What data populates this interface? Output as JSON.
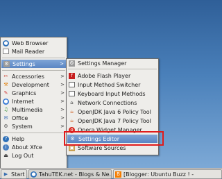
{
  "main_menu": {
    "items": [
      {
        "label": "Web Browser",
        "icon": "globe-icon",
        "submenu": false
      },
      {
        "label": "Mail Reader",
        "icon": "mail-icon",
        "submenu": false
      },
      {
        "label": "Settings",
        "icon": "settings-icon",
        "submenu": true,
        "highlighted": true
      },
      {
        "label": "Accessories",
        "icon": "accessories-icon",
        "submenu": true
      },
      {
        "label": "Development",
        "icon": "development-icon",
        "submenu": true
      },
      {
        "label": "Graphics",
        "icon": "graphics-icon",
        "submenu": true
      },
      {
        "label": "Internet",
        "icon": "internet-icon",
        "submenu": true
      },
      {
        "label": "Multimedia",
        "icon": "multimedia-icon",
        "submenu": true
      },
      {
        "label": "Office",
        "icon": "office-icon",
        "submenu": true
      },
      {
        "label": "System",
        "icon": "system-icon",
        "submenu": true
      },
      {
        "label": "Help",
        "icon": "help-icon",
        "submenu": false
      },
      {
        "label": "About Xfce",
        "icon": "info-icon",
        "submenu": false
      },
      {
        "label": "Log Out",
        "icon": "logout-icon",
        "submenu": false
      }
    ]
  },
  "settings_menu": {
    "items": [
      {
        "label": "Settings Manager",
        "icon": "settings-manager-icon"
      },
      {
        "label": "Adobe Flash Player",
        "icon": "flash-icon"
      },
      {
        "label": "Input Method Switcher",
        "icon": "keyboard-icon"
      },
      {
        "label": "Keyboard Input Methods",
        "icon": "keyboard-icon"
      },
      {
        "label": "Network Connections",
        "icon": "network-icon"
      },
      {
        "label": "OpenJDK Java 6 Policy Tool",
        "icon": "java-icon"
      },
      {
        "label": "OpenJDK Java 7 Policy Tool",
        "icon": "java-icon"
      },
      {
        "label": "Opera Widget Manager",
        "icon": "opera-icon"
      },
      {
        "label": "Settings Editor",
        "icon": "settings-editor-icon",
        "highlighted": true
      },
      {
        "label": "Software Sources",
        "icon": "software-sources-icon"
      }
    ]
  },
  "taskbar": {
    "start_label": "Start",
    "tasks": [
      {
        "label": "TahuTEK.net - Blogs & Ne...",
        "icon": "browser-icon"
      },
      {
        "label": "[Blogger: Ubuntu Buzz ! -",
        "icon": "blogger-icon"
      }
    ]
  },
  "colors": {
    "highlight": "#5a86c4",
    "annotation": "#e01b1b"
  }
}
